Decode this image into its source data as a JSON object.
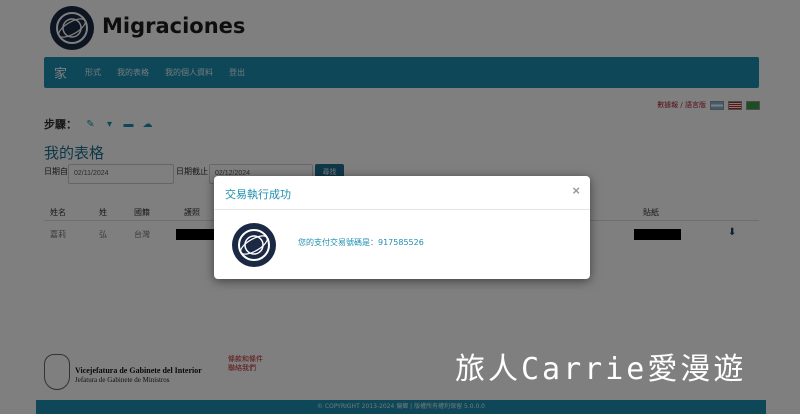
{
  "header": {
    "title": "Migraciones"
  },
  "nav": {
    "home": "家",
    "items": [
      "形式",
      "我的表格",
      "我的個人資料",
      "登出"
    ]
  },
  "lang": {
    "text": "數據報 / 語言版"
  },
  "steps": {
    "label": "步驟："
  },
  "page": {
    "title": "我的表格"
  },
  "filter": {
    "from_label": "日期自",
    "from_value": "02/11/2024",
    "to_label": "日期截止",
    "to_value": "02/12/2024",
    "search_label": "尋找"
  },
  "table": {
    "headers": [
      "姓名",
      "姓",
      "國籍",
      "護照",
      "貼紙"
    ],
    "row": {
      "first_name": "嘉莉",
      "last_name": "弘",
      "nationality": "台灣"
    }
  },
  "footer": {
    "org_name": "Vicejefatura de Gabinete del Interior",
    "org_sub": "Jefatura de Gabinete de Ministros",
    "links": [
      "條款和條件",
      "聯絡我們"
    ],
    "copyright": "© COPYRIGHT 2013-2024 偏鄉 | 版權所有權利保留 5.0.0.0"
  },
  "watermark": "旅人Carrie愛漫遊",
  "modal": {
    "title": "交易執行成功",
    "close": "×",
    "message": "您的支付交易號碼是：917585526"
  },
  "colors": {
    "primary": "#1c8fb0",
    "logo_bg": "#1b2944"
  }
}
